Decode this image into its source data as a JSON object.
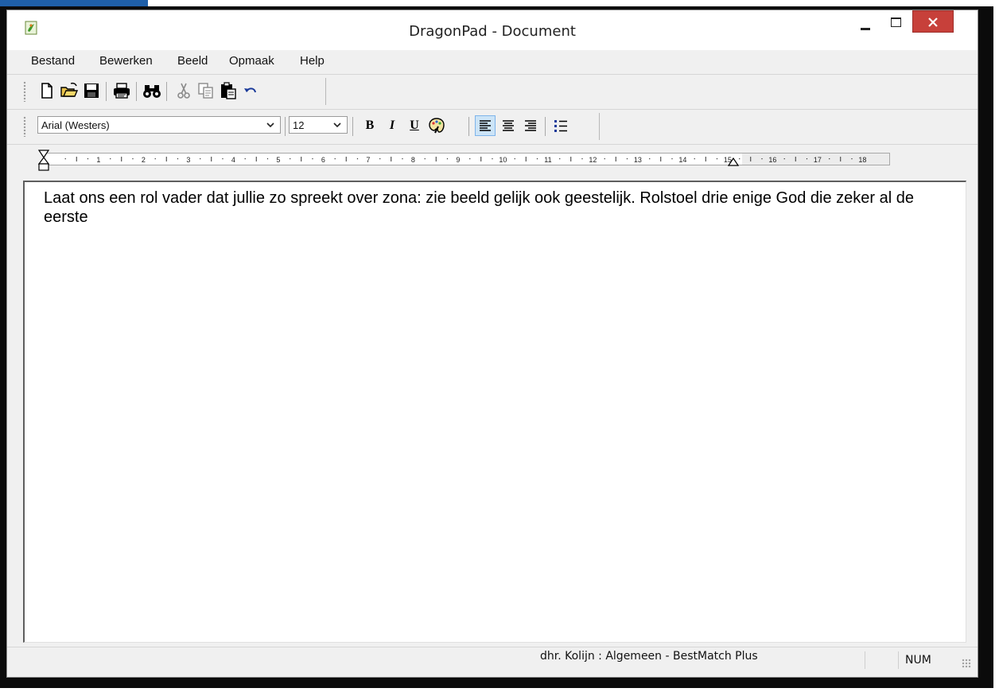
{
  "window": {
    "title": "DragonPad - Document",
    "accent_color": "#c7403a"
  },
  "menu": {
    "items": [
      {
        "label": "Bestand"
      },
      {
        "label": "Bewerken"
      },
      {
        "label": "Beeld"
      },
      {
        "label": "Opmaak"
      },
      {
        "label": "Help"
      }
    ]
  },
  "toolbar": {
    "buttons": [
      "new-document-icon",
      "open-folder-icon",
      "save-disk-icon",
      "print-icon",
      "find-binoculars-icon",
      "cut-scissors-icon",
      "copy-icon",
      "paste-icon",
      "undo-icon"
    ]
  },
  "format_bar": {
    "font_name": "Arial (Westers)",
    "font_size": "12",
    "bold_label": "B",
    "italic_label": "I",
    "underline_label": "U",
    "active_alignment": "align-left"
  },
  "ruler": {
    "labels": [
      "1",
      "2",
      "3",
      "4",
      "5",
      "6",
      "7",
      "8",
      "9",
      "10",
      "11",
      "12",
      "13",
      "14",
      "15",
      "16",
      "17",
      "18"
    ]
  },
  "document": {
    "text": "Laat ons een rol vader dat jullie zo spreekt over zona: zie beeld gelijk ook geestelijk. Rolstoel drie enige God die zeker al de eerste"
  },
  "status": {
    "user_profile": "dhr. Kolijn : Algemeen - BestMatch Plus",
    "num_lock": "NUM"
  }
}
